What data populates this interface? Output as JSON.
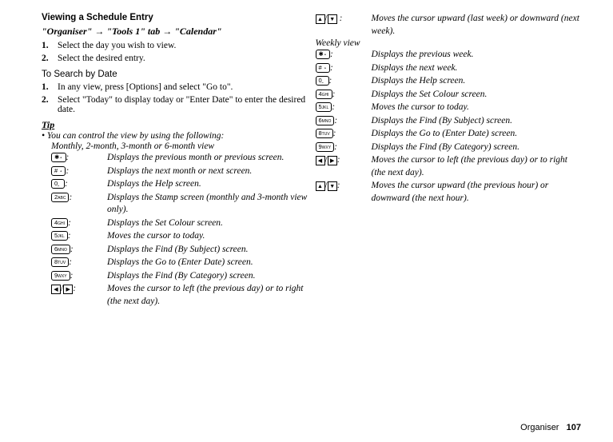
{
  "header": {
    "title": "Viewing a Schedule Entry",
    "nav": "\"Organiser\" → \"Tools 1\" tab → \"Calendar\""
  },
  "steps1": [
    {
      "num": "1.",
      "text": "Select the day you wish to view."
    },
    {
      "num": "2.",
      "text": "Select the desired entry."
    }
  ],
  "search_label": "To Search by Date",
  "steps2": [
    {
      "num": "1.",
      "text": "In any view, press [Options] and select \"Go to\"."
    },
    {
      "num": "2.",
      "text": "Select \"Today\" to display today or \"Enter Date\" to enter the desired date."
    }
  ],
  "tip_label": "Tip",
  "tip_bullet": "• You can control the view by using the following:",
  "view1_label": "Monthly, 2-month, 3-month or 6-month view",
  "monthly_keys": [
    {
      "icon": "star",
      "desc": "Displays the previous month or previous screen."
    },
    {
      "icon": "hash",
      "desc": "Displays the next month or next screen."
    },
    {
      "icon": "0",
      "desc": "Displays the Help screen."
    },
    {
      "icon": "2",
      "desc": "Displays the Stamp screen (monthly and 3-month view only)."
    },
    {
      "icon": "4",
      "desc": "Displays the Set Colour screen."
    },
    {
      "icon": "5",
      "desc": "Moves the cursor to today."
    },
    {
      "icon": "6",
      "desc": "Displays the Find (By Subject) screen."
    },
    {
      "icon": "8",
      "desc": "Displays the Go to (Enter Date) screen."
    },
    {
      "icon": "9",
      "desc": "Displays the Find (By Category) screen."
    },
    {
      "icon": "lr",
      "desc": "Moves the cursor to left (the previous day) or to right (the next day)."
    }
  ],
  "col2_top": {
    "icon": "ud",
    "desc": "Moves the cursor upward (last week) or downward (next week)."
  },
  "view2_label": "Weekly view",
  "weekly_keys": [
    {
      "icon": "star",
      "desc": "Displays the previous week."
    },
    {
      "icon": "hash",
      "desc": "Displays the next week."
    },
    {
      "icon": "0",
      "desc": "Displays the Help screen."
    },
    {
      "icon": "4",
      "desc": "Displays the Set Colour screen."
    },
    {
      "icon": "5",
      "desc": "Moves the cursor to today."
    },
    {
      "icon": "6",
      "desc": "Displays the Find (By Subject) screen."
    },
    {
      "icon": "8",
      "desc": "Displays the Go to (Enter Date) screen."
    },
    {
      "icon": "9",
      "desc": "Displays the Find (By Category) screen."
    },
    {
      "icon": "lr",
      "desc": "Moves the cursor to left (the previous day) or to right (the next day)."
    },
    {
      "icon": "ud",
      "desc": "Moves the cursor upward (the previous hour) or downward (the next hour)."
    }
  ],
  "footer": {
    "section": "Organiser",
    "page": "107"
  }
}
